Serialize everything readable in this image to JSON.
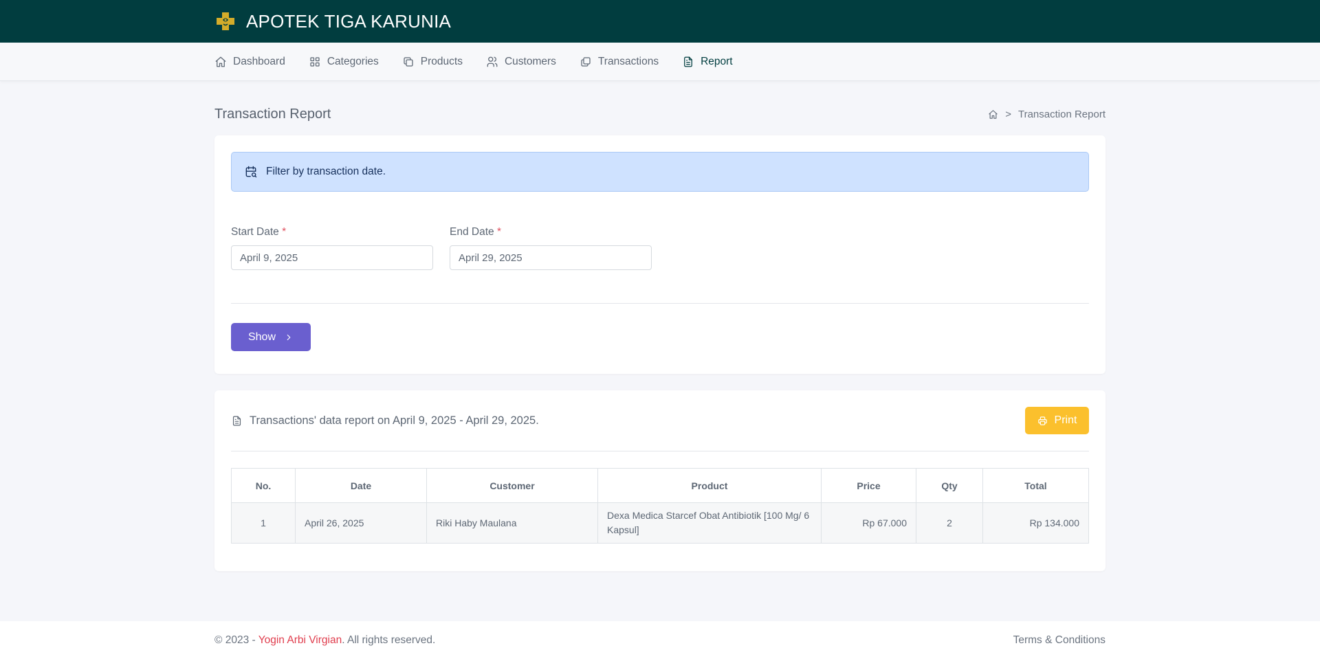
{
  "brand": {
    "name": "APOTEK TIGA KARUNIA",
    "logo_color": "#d4ac2a"
  },
  "nav": [
    {
      "label": "Dashboard",
      "icon": "home-icon"
    },
    {
      "label": "Categories",
      "icon": "grid-icon"
    },
    {
      "label": "Products",
      "icon": "copy-icon"
    },
    {
      "label": "Customers",
      "icon": "users-icon"
    },
    {
      "label": "Transactions",
      "icon": "stack-icon"
    },
    {
      "label": "Report",
      "icon": "file-text-icon",
      "active": true
    }
  ],
  "page": {
    "title": "Transaction Report",
    "breadcrumb_sep": ">",
    "breadcrumb_current": "Transaction Report"
  },
  "filter": {
    "alert_text": "Filter by transaction date.",
    "start_label": "Start Date",
    "end_label": "End Date",
    "required_mark": "*",
    "start_value": "April 9, 2025",
    "end_value": "April 29, 2025",
    "show_label": "Show"
  },
  "report": {
    "caption": "Transactions' data report on April 9, 2025 - April 29, 2025.",
    "print_label": "Print",
    "columns": [
      "No.",
      "Date",
      "Customer",
      "Product",
      "Price",
      "Qty",
      "Total"
    ],
    "rows": [
      {
        "no": "1",
        "date": "April 26, 2025",
        "customer": "Riki Haby Maulana",
        "product": "Dexa Medica Starcef Obat Antibiotik [100 Mg/ 6 Kapsul]",
        "price": "Rp 67.000",
        "qty": "2",
        "total": "Rp 134.000"
      }
    ]
  },
  "footer": {
    "copyright": "© 2023 - ",
    "author": "Yogin Arbi Virgian",
    "rights": ". All rights reserved.",
    "terms": "Terms & Conditions"
  },
  "colors": {
    "topbar": "#013d3f",
    "show_button": "#6a5fcf",
    "print_button": "#fbc02d",
    "alert_bg": "#cfe2ff",
    "author_link": "#e03e4e"
  }
}
